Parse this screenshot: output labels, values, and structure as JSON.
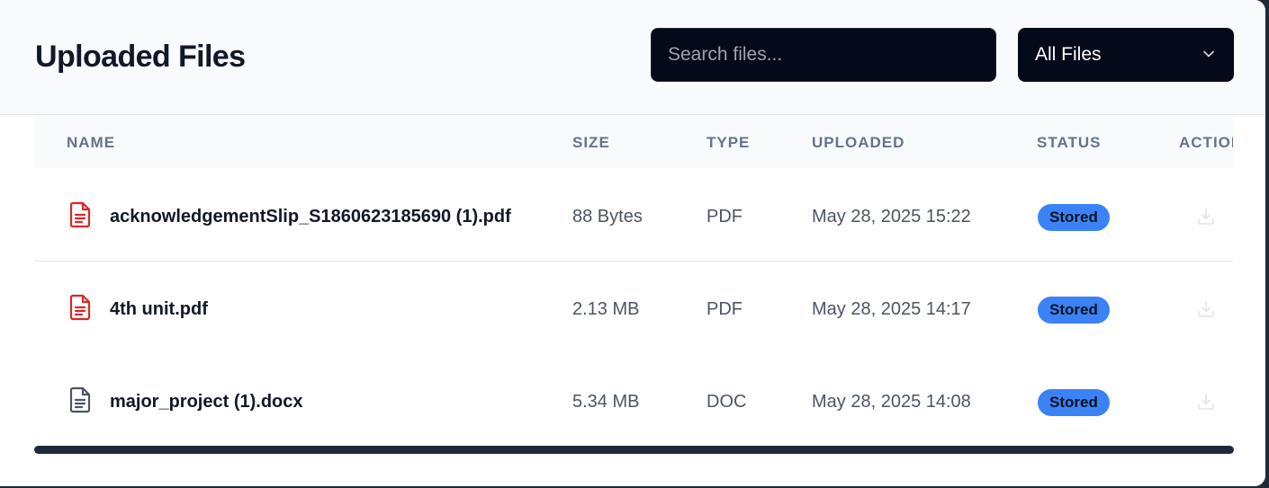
{
  "header": {
    "title": "Uploaded Files",
    "search_placeholder": "Search files...",
    "filter_value": "All Files"
  },
  "table": {
    "columns": [
      "NAME",
      "SIZE",
      "TYPE",
      "UPLOADED",
      "STATUS",
      "ACTIONS"
    ],
    "rows": [
      {
        "name": "acknowledgementSlip_S1860623185690 (1).pdf",
        "size": "88 Bytes",
        "type": "PDF",
        "uploaded": "May 28, 2025 15:22",
        "status": "Stored",
        "icon": "pdf-file-icon"
      },
      {
        "name": "4th unit.pdf",
        "size": "2.13 MB",
        "type": "PDF",
        "uploaded": "May 28, 2025 14:17",
        "status": "Stored",
        "icon": "pdf-file-icon"
      },
      {
        "name": "major_project (1).docx",
        "size": "5.34 MB",
        "type": "DOC",
        "uploaded": "May 28, 2025 14:08",
        "status": "Stored",
        "icon": "document-file-icon"
      }
    ]
  },
  "colors": {
    "pdf_icon": "#dc2626",
    "doc_icon": "#4b5563",
    "status_badge": "#3b82f6",
    "control_background": "#030a1a"
  }
}
